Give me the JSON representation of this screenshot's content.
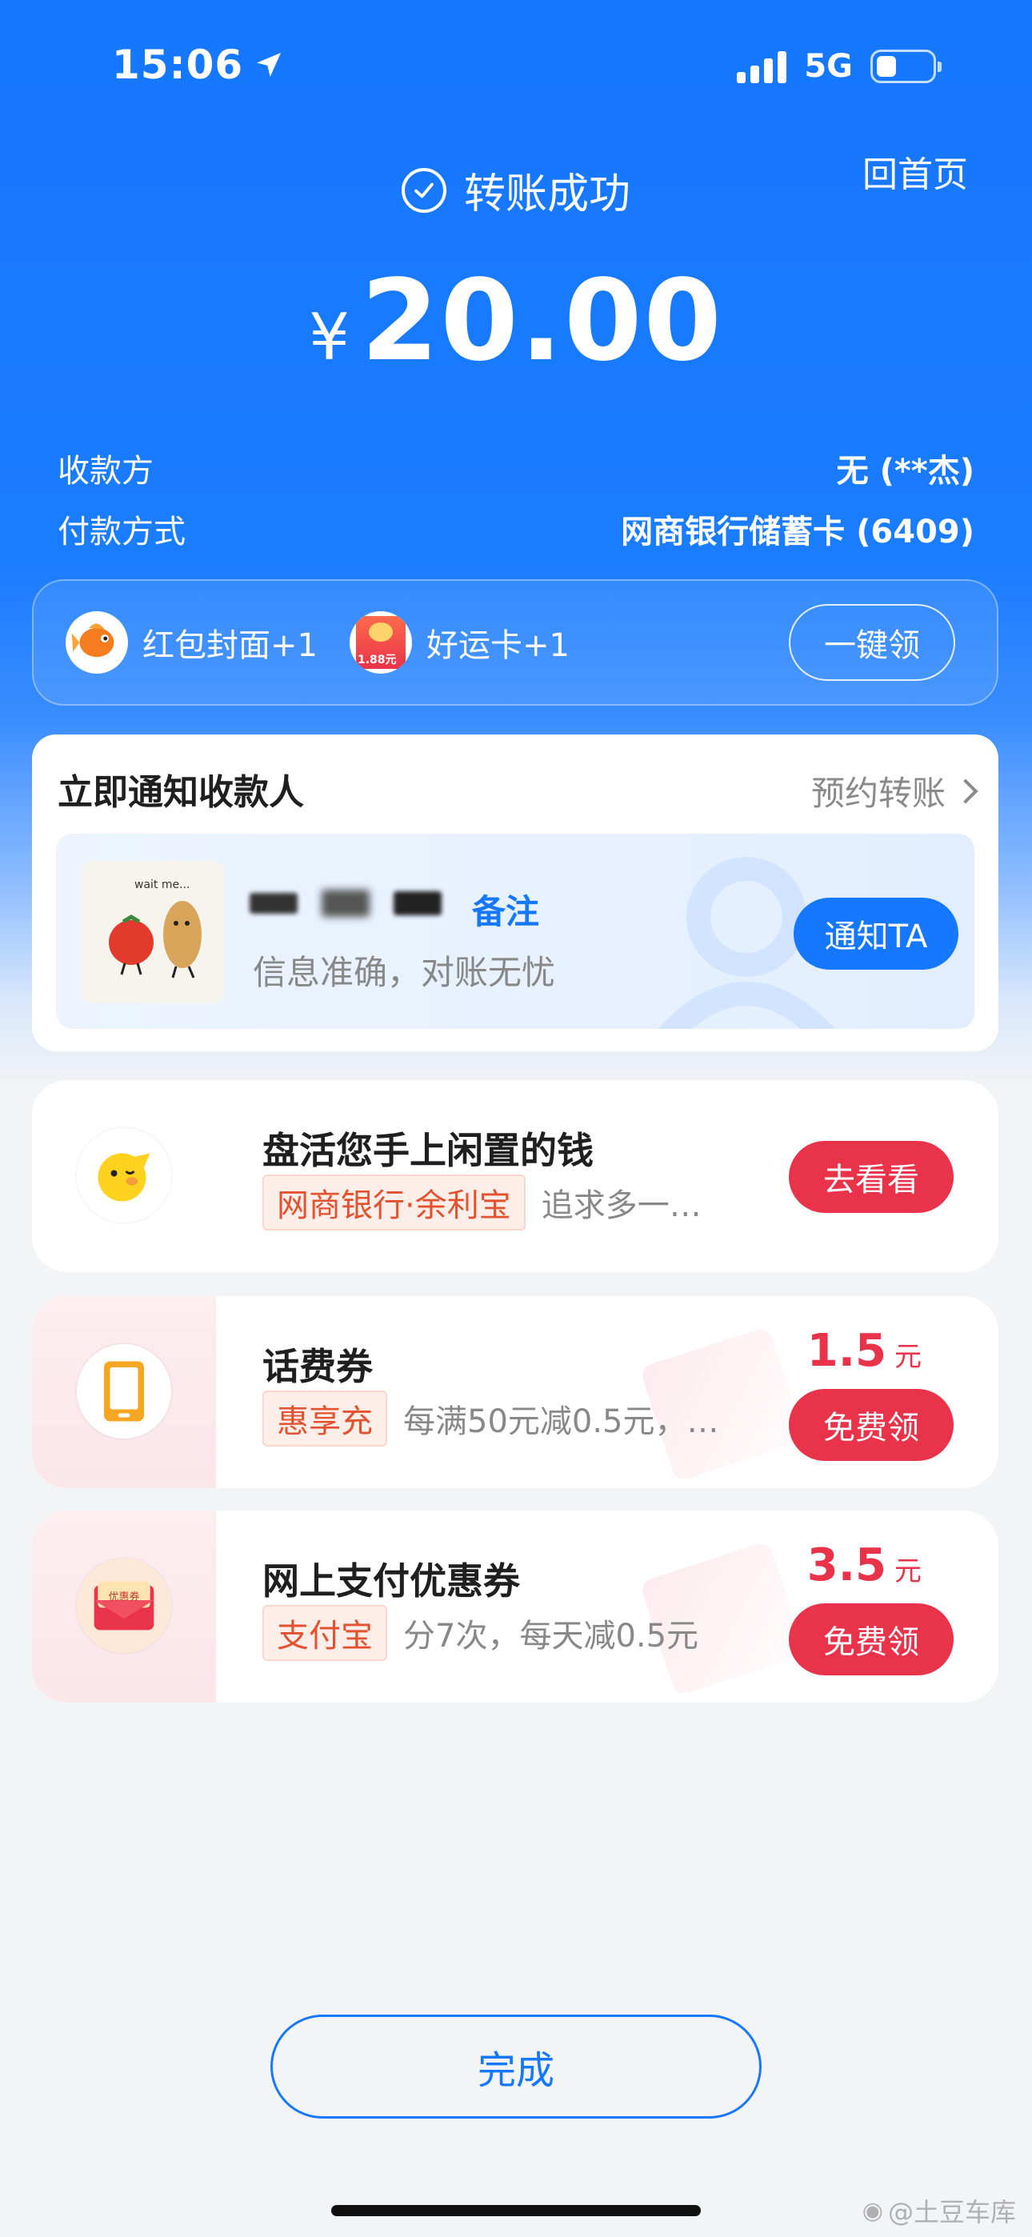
{
  "status_bar": {
    "time": "15:06",
    "network": "5G",
    "battery_level": 0.36
  },
  "header": {
    "home_link": "回首页",
    "status_text": "转账成功",
    "currency": "¥",
    "amount": "20.00"
  },
  "details": [
    {
      "label": "收款方",
      "value": "无 (**杰)"
    },
    {
      "label": "付款方式",
      "value": "网商银行储蓄卡 (6409)"
    }
  ],
  "rewards": {
    "items": [
      {
        "label": "红包封面+1",
        "icon": "goldfish-icon"
      },
      {
        "label": "好运卡+1",
        "icon": "lucky-card-icon",
        "badge": "1.88元"
      }
    ],
    "claim_all": "一键领"
  },
  "notify": {
    "title": "立即通知收款人",
    "schedule_link": "预约转账",
    "sticker_text": "wait me...",
    "remark_label": "备注",
    "subtitle": "信息准确，对账无忧",
    "button": "通知TA"
  },
  "offers": [
    {
      "title": "盘活您手上闲置的钱",
      "tag": "网商银行·余利宝",
      "desc": "追求多一…",
      "button": "去看看",
      "icon": "piggy-icon"
    },
    {
      "title": "话费券",
      "tag": "惠享充",
      "desc": "每满50元减0.5元，…",
      "price": "1.5",
      "unit": "元",
      "button": "免费领",
      "icon": "phone-icon"
    },
    {
      "title": "网上支付优惠券",
      "tag": "支付宝",
      "desc": "分7次，每天减0.5元",
      "price": "3.5",
      "unit": "元",
      "button": "免费领",
      "icon": "coupon-envelope-icon",
      "icon_text": "优惠券"
    }
  ],
  "footer": {
    "done_button": "完成",
    "watermark": "@土豆车库"
  },
  "colors": {
    "primary": "#1677ff",
    "accent_red": "#e8334a",
    "tag_orange": "#e2522f"
  }
}
